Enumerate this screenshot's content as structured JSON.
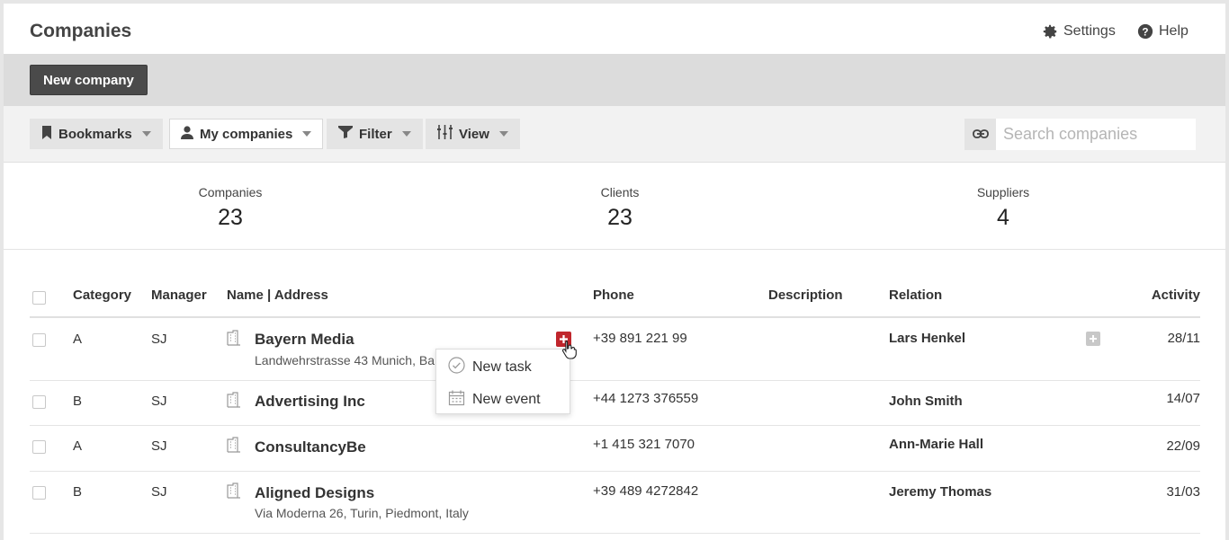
{
  "header": {
    "title": "Companies",
    "settings_label": "Settings",
    "help_label": "Help"
  },
  "actions": {
    "new_company_label": "New company"
  },
  "toolbar": {
    "bookmarks_label": "Bookmarks",
    "my_companies_label": "My companies",
    "filter_label": "Filter",
    "view_label": "View",
    "search_placeholder": "Search companies"
  },
  "stats": [
    {
      "label": "Companies",
      "value": "23"
    },
    {
      "label": "Clients",
      "value": "23"
    },
    {
      "label": "Suppliers",
      "value": "4"
    }
  ],
  "table": {
    "columns": {
      "category": "Category",
      "manager": "Manager",
      "name_address": "Name | Address",
      "phone": "Phone",
      "description": "Description",
      "relation": "Relation",
      "activity": "Activity"
    },
    "rows": [
      {
        "category": "A",
        "manager": "SJ",
        "name": "Bayern Media",
        "address": "Landwehrstrasse 43 Munich, Ba",
        "phone": "+39 891 221 99",
        "description": "",
        "relation": "Lars Henkel",
        "activity": "28/11"
      },
      {
        "category": "B",
        "manager": "SJ",
        "name": "Advertising Inc",
        "address": "",
        "phone": "+44 1273 376559",
        "description": "",
        "relation": "John Smith",
        "activity": "14/07"
      },
      {
        "category": "A",
        "manager": "SJ",
        "name": "ConsultancyBe",
        "address": "",
        "phone": "+1 415 321 7070",
        "description": "",
        "relation": "Ann-Marie Hall",
        "activity": "22/09"
      },
      {
        "category": "B",
        "manager": "SJ",
        "name": "Aligned Designs",
        "address": "Via Moderna 26, Turin, Piedmont, Italy",
        "phone": "+39 489 4272842",
        "description": "",
        "relation": "Jeremy Thomas",
        "activity": "31/03"
      }
    ]
  },
  "popup_menu": {
    "new_task_label": "New task",
    "new_event_label": "New event"
  },
  "colors": {
    "accent_red": "#c0262c",
    "dark_button": "#4a4a4a"
  }
}
